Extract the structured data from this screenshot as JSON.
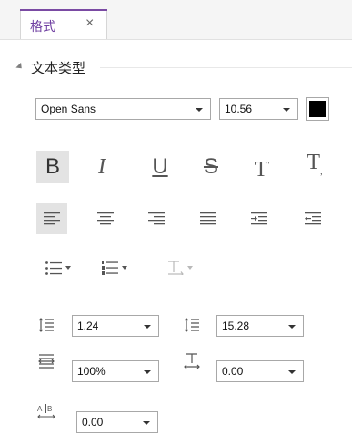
{
  "tab": {
    "label": "格式",
    "close": "×"
  },
  "section": {
    "title": "文本类型"
  },
  "font": {
    "family": "Open Sans",
    "size": "10.56",
    "color": "#000000"
  },
  "style_buttons": {
    "bold": "B",
    "italic": "I",
    "underline": "U",
    "strikethrough": "S",
    "superscript": "T",
    "subscript": "T"
  },
  "spacing": {
    "line_spacing": "1.24",
    "paragraph_spacing": "15.28",
    "horizontal_scale": "100%",
    "baseline_offset": "0.00",
    "char_spacing": "0.00"
  },
  "colors": {
    "accent": "#7a4aa3",
    "icon": "#555555"
  }
}
